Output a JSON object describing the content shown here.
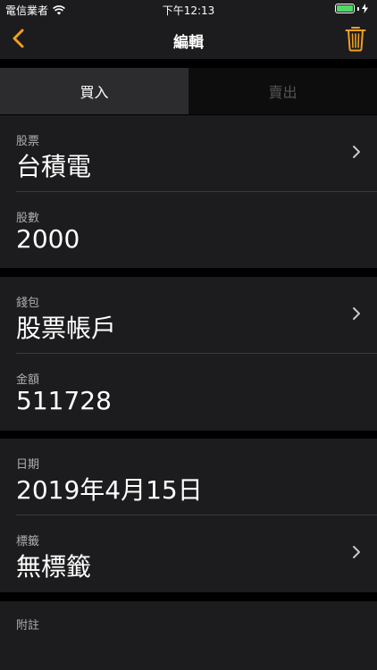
{
  "status_bar": {
    "carrier": "電信業者",
    "time": "下午12:13"
  },
  "nav": {
    "title": "編輯",
    "accent_color": "#f0a020"
  },
  "tabs": [
    {
      "label": "買入",
      "active": true
    },
    {
      "label": "賣出",
      "active": false
    }
  ],
  "stock": {
    "label": "股票",
    "value": "台積電"
  },
  "shares": {
    "label": "股數",
    "value": "2000"
  },
  "wallet": {
    "label": "錢包",
    "value": "股票帳戶"
  },
  "amount": {
    "label": "金額",
    "value": "511728"
  },
  "date": {
    "label": "日期",
    "value": "2019年4月15日"
  },
  "tag": {
    "label": "標籤",
    "value": "無標籤"
  },
  "note": {
    "label": "附註"
  }
}
